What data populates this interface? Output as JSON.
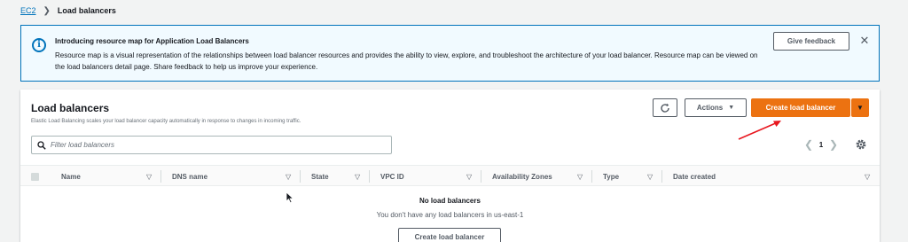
{
  "breadcrumb": {
    "link": "EC2",
    "separator": "❯",
    "current": "Load balancers"
  },
  "banner": {
    "title": "Introducing resource map for Application Load Balancers",
    "body": "Resource map is a visual representation of the relationships between load balancer resources and provides the ability to view, explore, and troubleshoot the architecture of your load balancer. Resource map can be viewed on the load balancers detail page. Share feedback to help us improve your experience.",
    "feedback_label": "Give feedback",
    "close_glyph": "✕",
    "info_glyph": "i"
  },
  "panel": {
    "title": "Load balancers",
    "description": "Elastic Load Balancing scales your load balancer capacity automatically in response to changes in incoming traffic.",
    "actions_label": "Actions",
    "create_label": "Create load balancer",
    "filter_placeholder": "Filter load balancers",
    "page_number": "1",
    "prev_glyph": "❮",
    "next_glyph": "❯"
  },
  "table": {
    "columns": [
      "Name",
      "DNS name",
      "State",
      "VPC ID",
      "Availability Zones",
      "Type",
      "Date created"
    ],
    "sort_glyph": "▽",
    "empty_title": "No load balancers",
    "empty_desc": "You don't have any load balancers in us-east-1",
    "empty_button": "Create load balancer"
  },
  "colors": {
    "accent": "#0073bb",
    "primary_button": "#ec7211",
    "annotation_arrow": "#e8171f"
  },
  "icons": {
    "info": "info-icon",
    "refresh": "refresh-icon",
    "settings": "settings-icon",
    "caret": "caret-down-icon",
    "search": "search-icon"
  }
}
